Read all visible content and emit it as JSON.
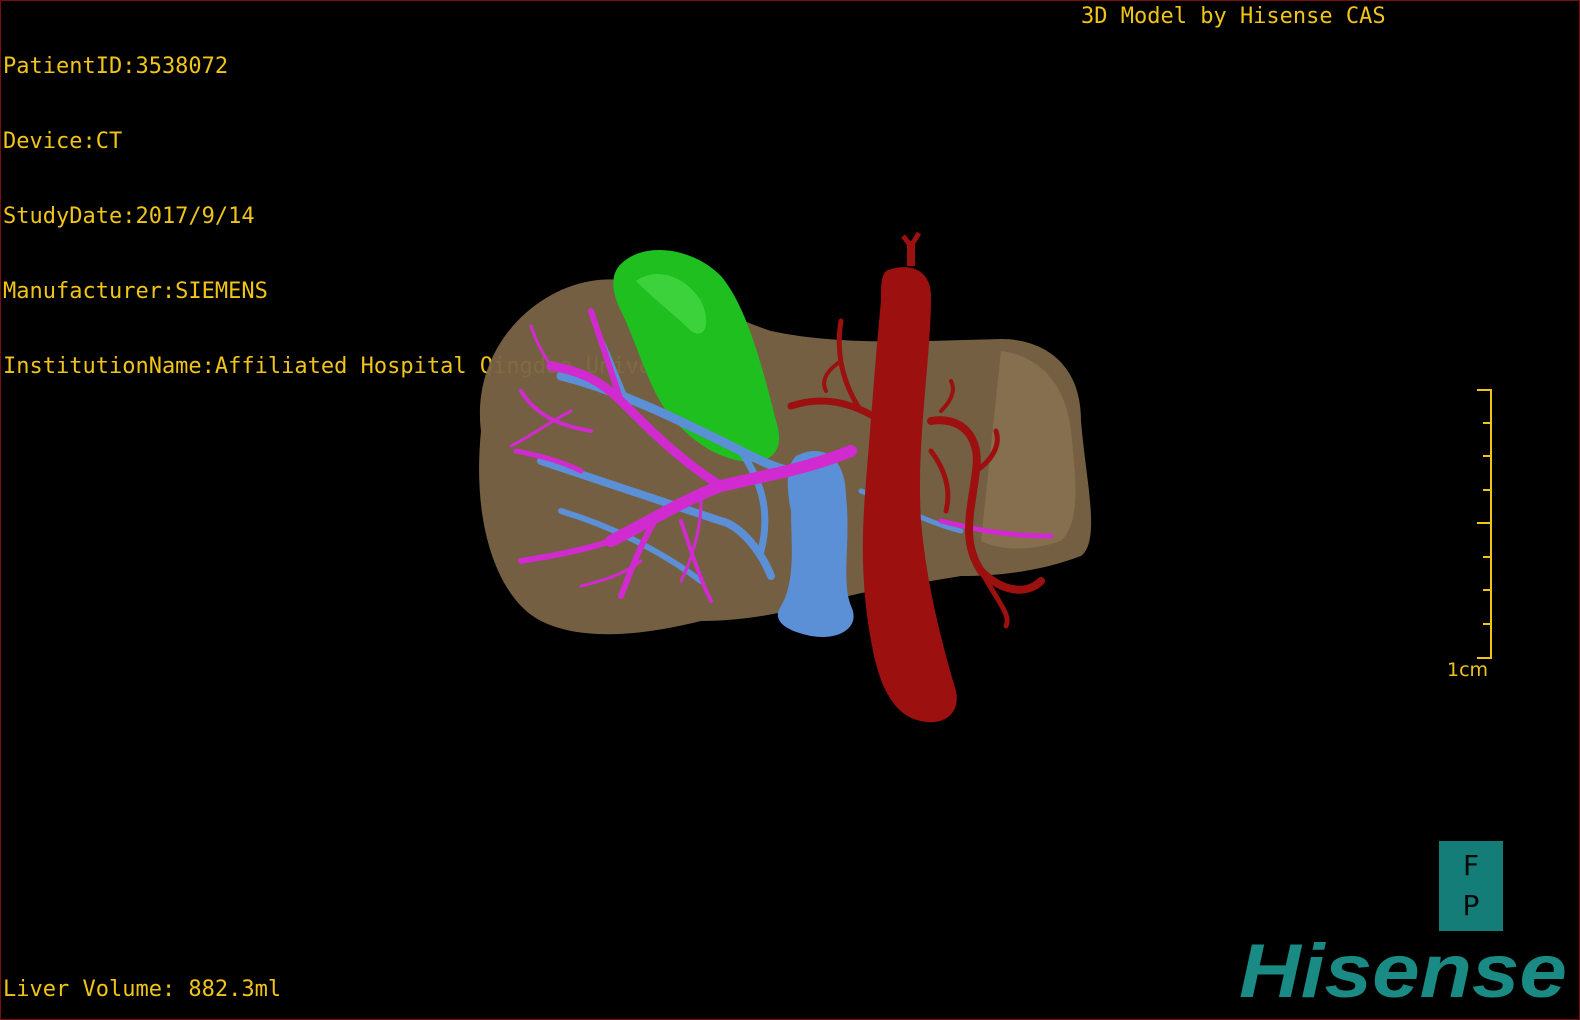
{
  "patient_info": {
    "patient_id": "PatientID:3538072",
    "device": "Device:CT",
    "study_date": "StudyDate:2017/9/14",
    "manufacturer": "Manufacturer:SIEMENS",
    "institution": "InstitutionName:Affiliated Hospital Qingdao University-C"
  },
  "model_credit": "3D Model by Hisense CAS",
  "liver_volume": "Liver Volume: 882.3ml",
  "scale": {
    "label": "1cm"
  },
  "orientation": {
    "top": "F",
    "bottom": "P"
  },
  "brand": {
    "logo_text": "Hisense",
    "color": "#1a8a84"
  },
  "colors": {
    "overlay_text": "#f0c419",
    "liver": "#7a6446",
    "gallbladder": "#1fbf1f",
    "portal_vein": "#d12ad1",
    "hepatic_vein": "#5b8fd6",
    "artery": "#9c1010"
  },
  "model_parts": [
    "liver",
    "gallbladder",
    "portal-vein",
    "hepatic-vein",
    "inferior-vena-cava",
    "hepatic-artery"
  ]
}
